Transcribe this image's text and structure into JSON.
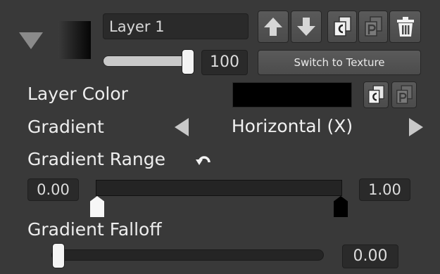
{
  "layer": {
    "name": "Layer 1",
    "opacity": "100",
    "opacity_level": 100,
    "switch_label": "Switch to Texture"
  },
  "buttons": {
    "move_up": "arrow-up-icon",
    "move_down": "arrow-down-icon",
    "copy": "copy-icon",
    "paste": "paste-icon",
    "delete": "trash-icon"
  },
  "layer_color": {
    "label": "Layer Color",
    "value": "#000000"
  },
  "gradient": {
    "label": "Gradient",
    "value": "Horizontal (X)"
  },
  "gradient_range": {
    "label": "Gradient Range",
    "min": "0.00",
    "max": "1.00",
    "start_color": "#ffffff",
    "end_color": "#000000"
  },
  "gradient_falloff": {
    "label": "Gradient Falloff",
    "value": "0.00",
    "level": 0
  }
}
